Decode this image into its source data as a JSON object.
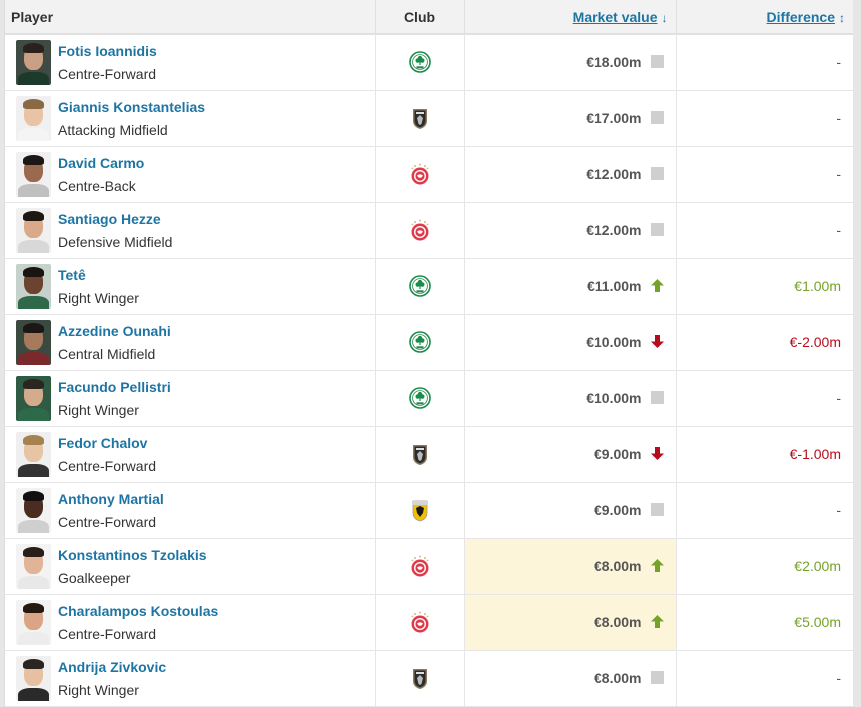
{
  "table": {
    "headers": {
      "player": "Player",
      "club": "Club",
      "market_value": "Market value",
      "market_value_sort_icon": "arrow-down",
      "difference": "Difference",
      "difference_sort_icon": "up-down-arrows"
    },
    "colors": {
      "link": "#1d75a3",
      "up": "#76a22b",
      "down": "#b60d1c",
      "highlight": "#fdf5da"
    },
    "rows": [
      {
        "name": "Fotis Ioannidis",
        "position": "Centre-Forward",
        "club": "Panathinaikos",
        "club_icon": "panathinaikos-crest",
        "market_value": "€18.00m",
        "trend": "neutral",
        "difference": "-",
        "highlight": false
      },
      {
        "name": "Giannis Konstantelias",
        "position": "Attacking Midfield",
        "club": "PAOK",
        "club_icon": "paok-crest",
        "market_value": "€17.00m",
        "trend": "neutral",
        "difference": "-",
        "highlight": false
      },
      {
        "name": "David Carmo",
        "position": "Centre-Back",
        "club": "Olympiacos",
        "club_icon": "olympiacos-crest",
        "market_value": "€12.00m",
        "trend": "neutral",
        "difference": "-",
        "highlight": false
      },
      {
        "name": "Santiago Hezze",
        "position": "Defensive Midfield",
        "club": "Olympiacos",
        "club_icon": "olympiacos-crest",
        "market_value": "€12.00m",
        "trend": "neutral",
        "difference": "-",
        "highlight": false
      },
      {
        "name": "Tetê",
        "position": "Right Winger",
        "club": "Panathinaikos",
        "club_icon": "panathinaikos-crest",
        "market_value": "€11.00m",
        "trend": "up",
        "difference": "€1.00m",
        "highlight": false
      },
      {
        "name": "Azzedine Ounahi",
        "position": "Central Midfield",
        "club": "Panathinaikos",
        "club_icon": "panathinaikos-crest",
        "market_value": "€10.00m",
        "trend": "down",
        "difference": "€-2.00m",
        "highlight": false
      },
      {
        "name": "Facundo Pellistri",
        "position": "Right Winger",
        "club": "Panathinaikos",
        "club_icon": "panathinaikos-crest",
        "market_value": "€10.00m",
        "trend": "neutral",
        "difference": "-",
        "highlight": false
      },
      {
        "name": "Fedor Chalov",
        "position": "Centre-Forward",
        "club": "PAOK",
        "club_icon": "paok-crest",
        "market_value": "€9.00m",
        "trend": "down",
        "difference": "€-1.00m",
        "highlight": false
      },
      {
        "name": "Anthony Martial",
        "position": "Centre-Forward",
        "club": "AEK Athens",
        "club_icon": "aek-crest",
        "market_value": "€9.00m",
        "trend": "neutral",
        "difference": "-",
        "highlight": false
      },
      {
        "name": "Konstantinos Tzolakis",
        "position": "Goalkeeper",
        "club": "Olympiacos",
        "club_icon": "olympiacos-crest",
        "market_value": "€8.00m",
        "trend": "up",
        "difference": "€2.00m",
        "highlight": true
      },
      {
        "name": "Charalampos Kostoulas",
        "position": "Centre-Forward",
        "club": "Olympiacos",
        "club_icon": "olympiacos-crest",
        "market_value": "€8.00m",
        "trend": "up",
        "difference": "€5.00m",
        "highlight": true
      },
      {
        "name": "Andrija Zivkovic",
        "position": "Right Winger",
        "club": "PAOK",
        "club_icon": "paok-crest",
        "market_value": "€8.00m",
        "trend": "neutral",
        "difference": "-",
        "highlight": false
      }
    ]
  }
}
